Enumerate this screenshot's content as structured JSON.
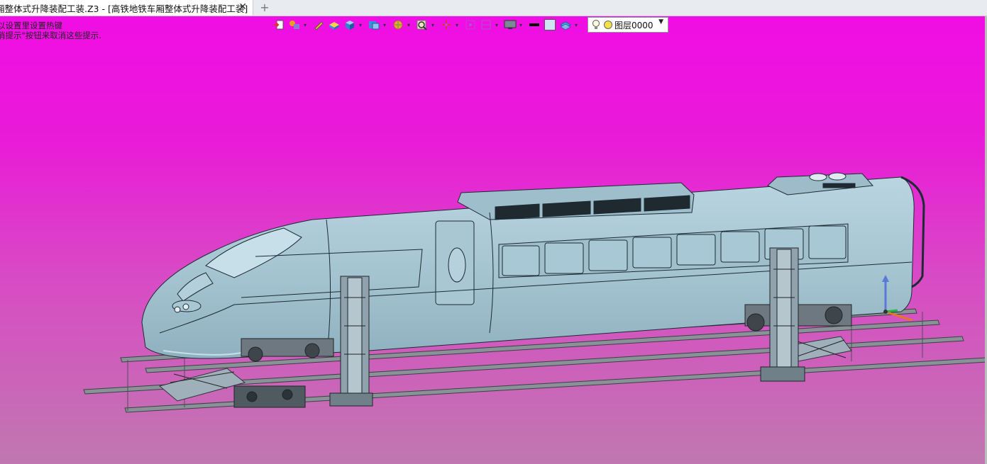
{
  "tab": {
    "title": "厢整体式升降装配工装.Z3 - [高铁地铁车厢整体式升降装配工装]",
    "close_label": "✕",
    "add_label": "+"
  },
  "hints": [
    "以设置里设置热键",
    "消提示\"按钮来取消这些提示."
  ],
  "toolbar": {
    "icons": [
      "exit-sketch-icon",
      "smart-pick-icon",
      "pencil-icon",
      "solid-box-icon",
      "cube-icon",
      "view-cube-icon",
      "shading-icon",
      "zoom-icon",
      "axis-icon",
      "select-box-icon",
      "section-view-icon",
      "monitor-icon",
      "line-color-swatch",
      "face-color-swatch",
      "layer-stack-icon"
    ],
    "layer": {
      "name": "图层0000"
    }
  },
  "colors": {
    "background_top": "#f20ce6",
    "background_bottom": "#c078b0",
    "train_body": "#a7c6d3",
    "train_outline": "#1c2a33"
  }
}
